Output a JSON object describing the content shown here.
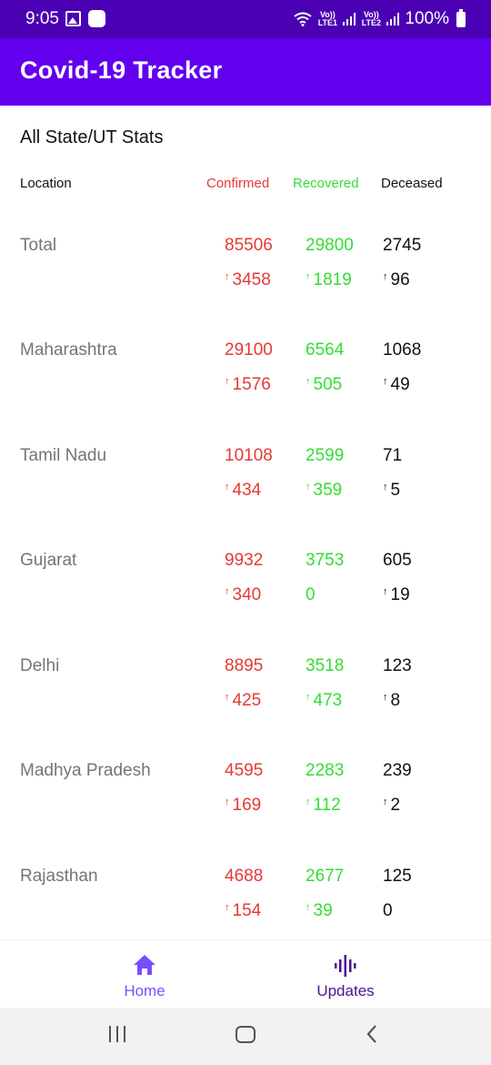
{
  "status_bar": {
    "time": "9:05",
    "signal1_label": "Vo)) LTE1",
    "signal2_label": "Vo)) LTE2",
    "battery": "100%"
  },
  "app_bar": {
    "title": "Covid-19 Tracker"
  },
  "section_title": "All State/UT Stats",
  "columns": {
    "location": "Location",
    "confirmed": "Confirmed",
    "recovered": "Recovered",
    "deceased": "Deceased"
  },
  "colors": {
    "primary": "#6200ee",
    "status_bar": "#4b00b3",
    "confirmed": "#e53935",
    "recovered": "#33dd33"
  },
  "rows": [
    {
      "name": "Total",
      "confirmed": "85506",
      "recovered": "29800",
      "deceased": "2745",
      "d_confirmed": "3458",
      "d_recovered": "1819",
      "d_deceased": "96"
    },
    {
      "name": "Maharashtra",
      "confirmed": "29100",
      "recovered": "6564",
      "deceased": "1068",
      "d_confirmed": "1576",
      "d_recovered": "505",
      "d_deceased": "49"
    },
    {
      "name": "Tamil Nadu",
      "confirmed": "10108",
      "recovered": "2599",
      "deceased": "71",
      "d_confirmed": "434",
      "d_recovered": "359",
      "d_deceased": "5"
    },
    {
      "name": "Gujarat",
      "confirmed": "9932",
      "recovered": "3753",
      "deceased": "605",
      "d_confirmed": "340",
      "d_recovered": "0",
      "d_deceased": "19"
    },
    {
      "name": "Delhi",
      "confirmed": "8895",
      "recovered": "3518",
      "deceased": "123",
      "d_confirmed": "425",
      "d_recovered": "473",
      "d_deceased": "8"
    },
    {
      "name": "Madhya Pradesh",
      "confirmed": "4595",
      "recovered": "2283",
      "deceased": "239",
      "d_confirmed": "169",
      "d_recovered": "112",
      "d_deceased": "2"
    },
    {
      "name": "Rajasthan",
      "confirmed": "4688",
      "recovered": "2677",
      "deceased": "125",
      "d_confirmed": "154",
      "d_recovered": "39",
      "d_deceased": "0"
    }
  ],
  "bottom_nav": {
    "home": {
      "label": "Home",
      "icon": "home-icon"
    },
    "updates": {
      "label": "Updates",
      "icon": "audio-wave-icon"
    }
  }
}
